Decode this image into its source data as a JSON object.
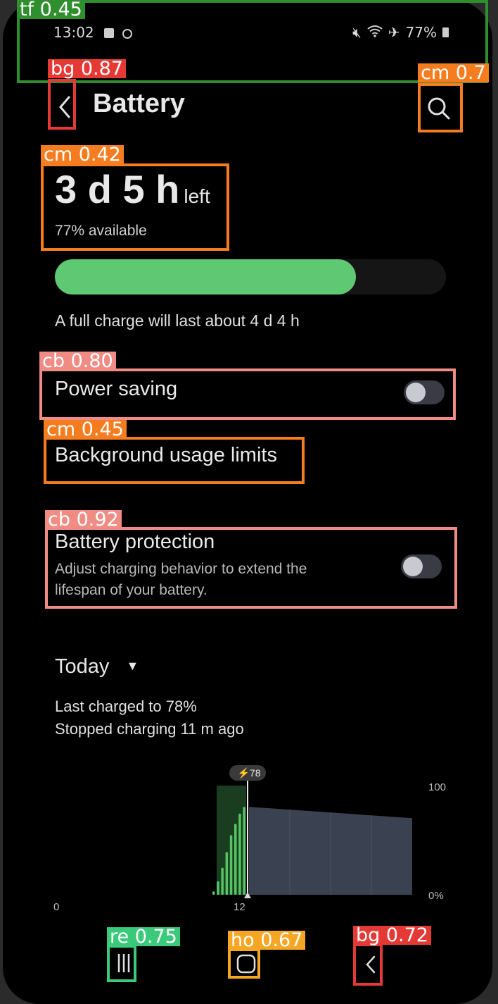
{
  "status_bar": {
    "time": "13:02",
    "battery": "77%"
  },
  "header": {
    "title": "Battery"
  },
  "summary": {
    "time_left": "3 d 5 h",
    "left_suffix": "left",
    "available": "77% available",
    "level_fraction": 0.77,
    "full_charge": "A full charge will last about 4 d 4 h"
  },
  "settings": {
    "power_saving": {
      "label": "Power saving",
      "enabled": false
    },
    "background_limits": {
      "label": "Background usage limits"
    },
    "battery_protection": {
      "label": "Battery protection",
      "description_line1": "Adjust charging behavior to extend the",
      "description_line2": "lifespan of your battery.",
      "enabled": false
    }
  },
  "usage": {
    "period": "Today",
    "last_charged": "Last charged to 78%",
    "stopped": "Stopped charging 11 m ago"
  },
  "chart_data": {
    "type": "bar",
    "marker_label": "78",
    "x_tick_labels": [
      "0",
      "12"
    ],
    "y_tick_labels": [
      "100",
      "0%"
    ],
    "ylim": [
      0,
      100
    ],
    "charging_bars": [
      3,
      12,
      24,
      38,
      53,
      63,
      72,
      78
    ],
    "projection_start": 78,
    "projection_end": 68
  },
  "detections": [
    {
      "label": "tf",
      "score": "0.45",
      "color": "#2f8f2f"
    },
    {
      "label": "bg",
      "score": "0.87",
      "color": "#e53935"
    },
    {
      "label": "cm",
      "score": "0.7",
      "color": "#f57c1f"
    },
    {
      "label": "cm",
      "score": "0.42",
      "color": "#f57c1f"
    },
    {
      "label": "cb",
      "score": "0.80",
      "color": "#f08c84"
    },
    {
      "label": "cm",
      "score": "0.45",
      "color": "#f57c1f"
    },
    {
      "label": "cb",
      "score": "0.92",
      "color": "#f08c84"
    },
    {
      "label": "re",
      "score": "0.75",
      "color": "#3bc97a"
    },
    {
      "label": "ho",
      "score": "0.67",
      "color": "#f5a623"
    },
    {
      "label": "bg",
      "score": "0.72",
      "color": "#e53935"
    }
  ]
}
